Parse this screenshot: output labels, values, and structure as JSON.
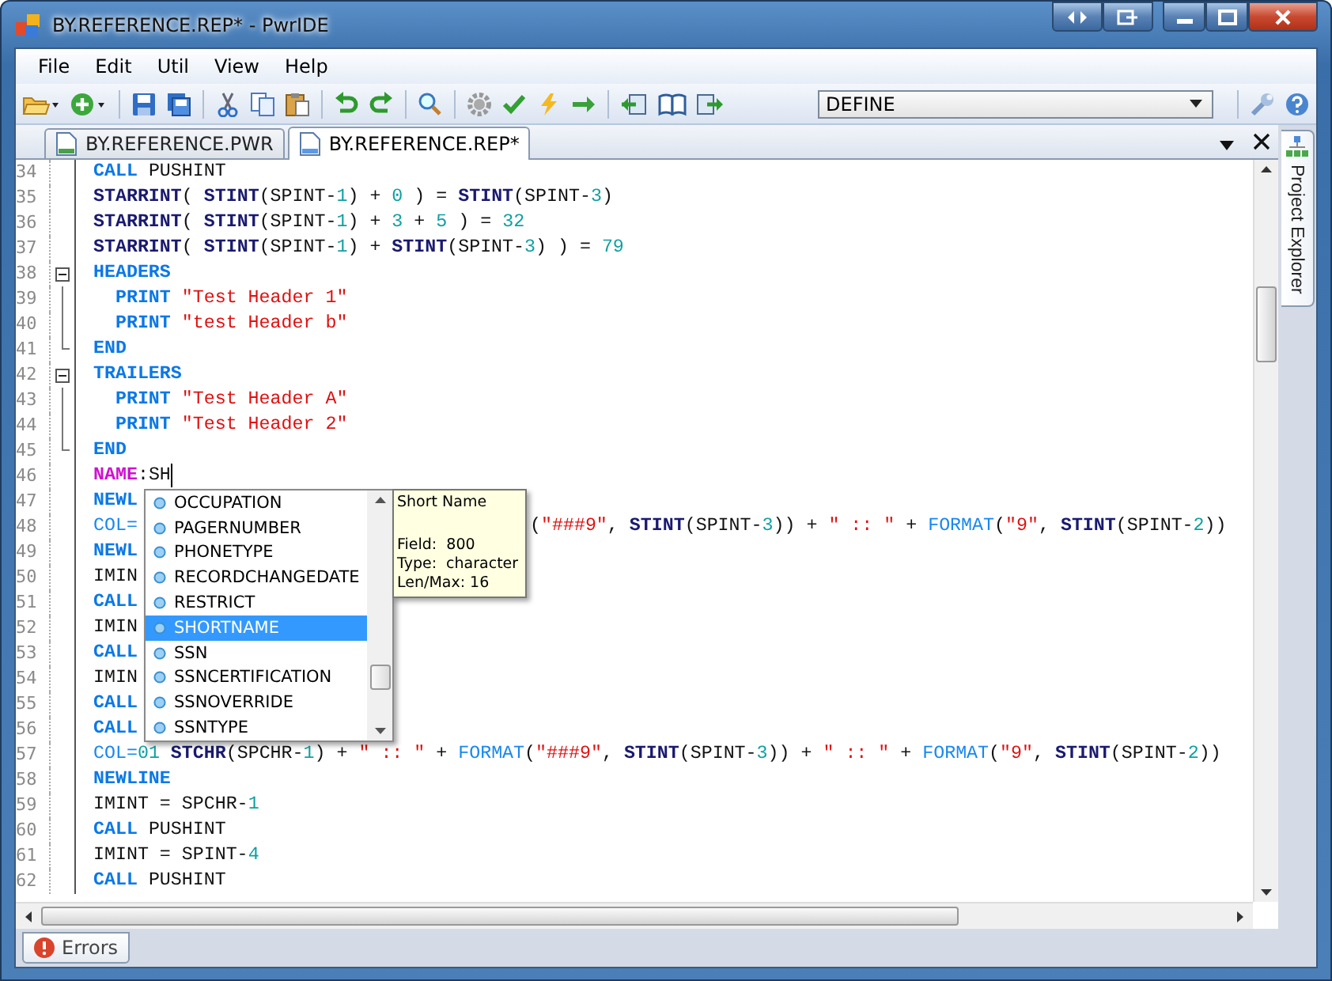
{
  "window": {
    "title": "BY.REFERENCE.REP* - PwrIDE"
  },
  "menu": [
    {
      "label": "File"
    },
    {
      "label": "Edit"
    },
    {
      "label": "Util"
    },
    {
      "label": "View"
    },
    {
      "label": "Help"
    }
  ],
  "toolbar": {
    "define_select": "DEFINE"
  },
  "tabs": [
    {
      "label": "BY.REFERENCE.PWR",
      "selected": false
    },
    {
      "label": "BY.REFERENCE.REP*",
      "selected": true
    }
  ],
  "side_panel": {
    "label": "Project Explorer"
  },
  "code_lines": [
    {
      "n": "34",
      "kind": "plain",
      "tokens": [
        {
          "kind": "cmd",
          "t": "CALL"
        },
        {
          "kind": "plain",
          "t": " PUSHINT"
        }
      ]
    },
    {
      "n": "35",
      "kind": "plain",
      "tokens": [
        {
          "kind": "kw",
          "t": "STARRINT"
        },
        {
          "kind": "plain",
          "t": "( "
        },
        {
          "kind": "kw",
          "t": "STINT"
        },
        {
          "kind": "plain",
          "t": "(SPINT-"
        },
        {
          "kind": "num",
          "t": "1"
        },
        {
          "kind": "plain",
          "t": ") + "
        },
        {
          "kind": "num",
          "t": "0"
        },
        {
          "kind": "plain",
          "t": " ) = "
        },
        {
          "kind": "kw",
          "t": "STINT"
        },
        {
          "kind": "plain",
          "t": "(SPINT-"
        },
        {
          "kind": "num",
          "t": "3"
        },
        {
          "kind": "plain",
          "t": ")"
        }
      ]
    },
    {
      "n": "36",
      "kind": "plain",
      "tokens": [
        {
          "kind": "kw",
          "t": "STARRINT"
        },
        {
          "kind": "plain",
          "t": "( "
        },
        {
          "kind": "kw",
          "t": "STINT"
        },
        {
          "kind": "plain",
          "t": "(SPINT-"
        },
        {
          "kind": "num",
          "t": "1"
        },
        {
          "kind": "plain",
          "t": ") + "
        },
        {
          "kind": "num",
          "t": "3"
        },
        {
          "kind": "plain",
          "t": " + "
        },
        {
          "kind": "num",
          "t": "5"
        },
        {
          "kind": "plain",
          "t": " ) = "
        },
        {
          "kind": "num",
          "t": "32"
        }
      ]
    },
    {
      "n": "37",
      "kind": "plain",
      "tokens": [
        {
          "kind": "kw",
          "t": "STARRINT"
        },
        {
          "kind": "plain",
          "t": "( "
        },
        {
          "kind": "kw",
          "t": "STINT"
        },
        {
          "kind": "plain",
          "t": "(SPINT-"
        },
        {
          "kind": "num",
          "t": "1"
        },
        {
          "kind": "plain",
          "t": ") + "
        },
        {
          "kind": "kw",
          "t": "STINT"
        },
        {
          "kind": "plain",
          "t": "(SPINT-"
        },
        {
          "kind": "num",
          "t": "3"
        },
        {
          "kind": "plain",
          "t": ") ) = "
        },
        {
          "kind": "num",
          "t": "79"
        }
      ]
    },
    {
      "n": "38",
      "kind": "fold_start",
      "tokens": [
        {
          "kind": "cmd",
          "t": "HEADERS"
        }
      ]
    },
    {
      "n": "39",
      "kind": "fold_inner",
      "tokens": [
        {
          "kind": "cmd",
          "t": "  PRINT"
        },
        {
          "kind": "str",
          "t": " \"Test Header 1\""
        }
      ]
    },
    {
      "n": "40",
      "kind": "fold_inner",
      "tokens": [
        {
          "kind": "cmd",
          "t": "  PRINT"
        },
        {
          "kind": "str",
          "t": " \"test Header b\""
        }
      ]
    },
    {
      "n": "41",
      "kind": "fold_end",
      "tokens": [
        {
          "kind": "cmd",
          "t": "END"
        }
      ]
    },
    {
      "n": "42",
      "kind": "fold_start",
      "tokens": [
        {
          "kind": "cmd",
          "t": "TRAILERS"
        }
      ]
    },
    {
      "n": "43",
      "kind": "fold_inner",
      "tokens": [
        {
          "kind": "cmd",
          "t": "  PRINT"
        },
        {
          "kind": "str",
          "t": " \"Test Header A\""
        }
      ]
    },
    {
      "n": "44",
      "kind": "fold_inner",
      "tokens": [
        {
          "kind": "cmd",
          "t": "  PRINT"
        },
        {
          "kind": "str",
          "t": " \"Test Header 2\""
        }
      ]
    },
    {
      "n": "45",
      "kind": "fold_end",
      "tokens": [
        {
          "kind": "cmd",
          "t": "END"
        }
      ]
    },
    {
      "n": "46",
      "kind": "plain",
      "caret": true,
      "tokens": [
        {
          "kind": "label",
          "t": "NAME"
        },
        {
          "kind": "plain",
          "t": ":SH"
        }
      ]
    },
    {
      "n": "47",
      "kind": "plain",
      "tokens": [
        {
          "kind": "cmd",
          "t": "NEWL"
        }
      ]
    },
    {
      "n": "48",
      "kind": "plain",
      "tokens": [
        {
          "kind": "func",
          "t": "COL="
        }
      ],
      "tokens_after_popup": [
        {
          "kind": "plain",
          "t": "("
        },
        {
          "kind": "str",
          "t": "\"###9\""
        },
        {
          "kind": "plain",
          "t": ", "
        },
        {
          "kind": "kw",
          "t": "STINT"
        },
        {
          "kind": "plain",
          "t": "(SPINT-"
        },
        {
          "kind": "num",
          "t": "3"
        },
        {
          "kind": "plain",
          "t": ")) + "
        },
        {
          "kind": "str",
          "t": "\" :: \""
        },
        {
          "kind": "plain",
          "t": " + "
        },
        {
          "kind": "func",
          "t": "FORMAT"
        },
        {
          "kind": "plain",
          "t": "("
        },
        {
          "kind": "str",
          "t": "\"9\""
        },
        {
          "kind": "plain",
          "t": ", "
        },
        {
          "kind": "kw",
          "t": "STINT"
        },
        {
          "kind": "plain",
          "t": "(SPINT-"
        },
        {
          "kind": "num",
          "t": "2"
        },
        {
          "kind": "plain",
          "t": "))"
        }
      ]
    },
    {
      "n": "49",
      "kind": "plain",
      "tokens": [
        {
          "kind": "cmd",
          "t": "NEWL"
        }
      ]
    },
    {
      "n": "50",
      "kind": "plain",
      "tokens": [
        {
          "kind": "plain",
          "t": "IMIN"
        }
      ]
    },
    {
      "n": "51",
      "kind": "plain",
      "tokens": [
        {
          "kind": "cmd",
          "t": "CALL"
        }
      ]
    },
    {
      "n": "52",
      "kind": "plain",
      "tokens": [
        {
          "kind": "plain",
          "t": "IMIN"
        }
      ]
    },
    {
      "n": "53",
      "kind": "plain",
      "tokens": [
        {
          "kind": "cmd",
          "t": "CALL"
        }
      ]
    },
    {
      "n": "54",
      "kind": "plain",
      "tokens": [
        {
          "kind": "plain",
          "t": "IMIN"
        }
      ]
    },
    {
      "n": "55",
      "kind": "plain",
      "tokens": [
        {
          "kind": "cmd",
          "t": "CALL"
        }
      ]
    },
    {
      "n": "56",
      "kind": "plain",
      "tokens": [
        {
          "kind": "cmd",
          "t": "CALL"
        }
      ]
    },
    {
      "n": "57",
      "kind": "plain",
      "tokens": [
        {
          "kind": "func",
          "t": "COL="
        },
        {
          "kind": "num",
          "t": "01"
        },
        {
          "kind": "kw",
          "t": " STCHR"
        },
        {
          "kind": "plain",
          "t": "(SPCHR-"
        },
        {
          "kind": "num",
          "t": "1"
        },
        {
          "kind": "plain",
          "t": ") + "
        },
        {
          "kind": "str",
          "t": "\" :: \""
        },
        {
          "kind": "plain",
          "t": " + "
        },
        {
          "kind": "func",
          "t": "FORMAT"
        },
        {
          "kind": "plain",
          "t": "("
        },
        {
          "kind": "str",
          "t": "\"###9\""
        },
        {
          "kind": "plain",
          "t": ", "
        },
        {
          "kind": "kw",
          "t": "STINT"
        },
        {
          "kind": "plain",
          "t": "(SPINT-"
        },
        {
          "kind": "num",
          "t": "3"
        },
        {
          "kind": "plain",
          "t": ")) + "
        },
        {
          "kind": "str",
          "t": "\" :: \""
        },
        {
          "kind": "plain",
          "t": " + "
        },
        {
          "kind": "func",
          "t": "FORMAT"
        },
        {
          "kind": "plain",
          "t": "("
        },
        {
          "kind": "str",
          "t": "\"9\""
        },
        {
          "kind": "plain",
          "t": ", "
        },
        {
          "kind": "kw",
          "t": "STINT"
        },
        {
          "kind": "plain",
          "t": "(SPINT-"
        },
        {
          "kind": "num",
          "t": "2"
        },
        {
          "kind": "plain",
          "t": "))"
        }
      ]
    },
    {
      "n": "58",
      "kind": "plain",
      "tokens": [
        {
          "kind": "cmd",
          "t": "NEWLINE"
        }
      ]
    },
    {
      "n": "59",
      "kind": "plain",
      "tokens": [
        {
          "kind": "plain",
          "t": "IMINT = SPCHR-"
        },
        {
          "kind": "num",
          "t": "1"
        }
      ]
    },
    {
      "n": "60",
      "kind": "plain",
      "tokens": [
        {
          "kind": "cmd",
          "t": "CALL"
        },
        {
          "kind": "plain",
          "t": " PUSHINT"
        }
      ]
    },
    {
      "n": "61",
      "kind": "plain",
      "tokens": [
        {
          "kind": "plain",
          "t": "IMINT = SPINT-"
        },
        {
          "kind": "num",
          "t": "4"
        }
      ]
    },
    {
      "n": "62",
      "kind": "plain",
      "tokens": [
        {
          "kind": "cmd",
          "t": "CALL"
        },
        {
          "kind": "plain",
          "t": " PUSHINT"
        }
      ]
    }
  ],
  "completion": {
    "items": [
      {
        "label": "OCCUPATION",
        "selected": false
      },
      {
        "label": "PAGERNUMBER",
        "selected": false
      },
      {
        "label": "PHONETYPE",
        "selected": false
      },
      {
        "label": "RECORDCHANGEDATE",
        "selected": false
      },
      {
        "label": "RESTRICT",
        "selected": false
      },
      {
        "label": "SHORTNAME",
        "selected": true
      },
      {
        "label": "SSN",
        "selected": false
      },
      {
        "label": "SSNCERTIFICATION",
        "selected": false
      },
      {
        "label": "SSNOVERRIDE",
        "selected": false
      },
      {
        "label": "SSNTYPE",
        "selected": false
      }
    ],
    "tooltip": {
      "title": "Short Name",
      "lines": [
        "Field:  800",
        "Type:  character",
        "Len/Max: 16"
      ]
    }
  },
  "bottom_tabs": [
    {
      "label": "Errors",
      "selected": true
    }
  ]
}
